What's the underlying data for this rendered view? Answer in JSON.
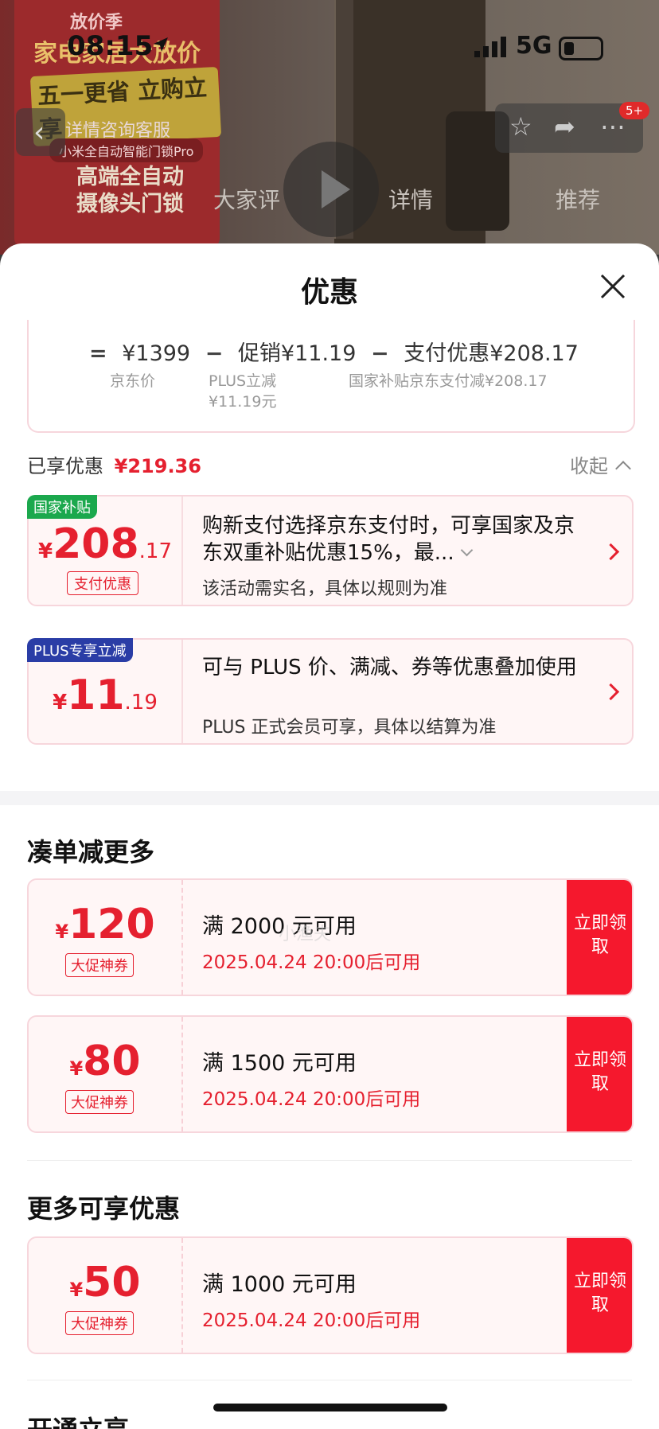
{
  "status_bar": {
    "time": "08:15",
    "network": "5G"
  },
  "backdrop": {
    "promo_top": "放价季",
    "promo_line1": "家电家居大放价",
    "promo_line2": "五一更省 立购立享",
    "consult": "详情咨询客服",
    "product_chip": "小米全自动智能门锁Pro",
    "product_big_1": "高端全自动",
    "product_big_2": "摄像头门锁",
    "tabs": [
      "大家评",
      "详情",
      "推荐"
    ],
    "cart_badge": "5+"
  },
  "sheet": {
    "title": "优惠",
    "calc": {
      "eq": "=",
      "price": "¥1399",
      "minus": "−",
      "promo": "促销¥11.19",
      "pay": "支付优惠¥208.17",
      "price_label": "京东价",
      "promo_label_1": "PLUS立减",
      "promo_label_2": "¥11.19元",
      "pay_label": "国家补贴京东支付减¥208.17"
    },
    "enjoyed_label": "已享优惠",
    "enjoyed_amount": "¥219.36",
    "collapse_label": "收起",
    "promos": [
      {
        "tag": "国家补贴",
        "currency": "¥",
        "int": "208",
        "dec": ".17",
        "chip": "支付优惠",
        "text": "购新支付选择京东支付时，可享国家及京东双重补贴优惠15%，最...",
        "sub": "该活动需实名，具体以规则为准"
      },
      {
        "tag": "PLUS专享立减",
        "currency": "¥",
        "int": "11",
        "dec": ".19",
        "text": "可与 PLUS 价、满减、券等优惠叠加使用",
        "sub": "PLUS 正式会员可享，具体以结算为准"
      }
    ],
    "section_more": "凑单减更多",
    "coupons_more": [
      {
        "currency": "¥",
        "amount": "120",
        "chip": "大促神券",
        "condition": "满 2000 元可用",
        "time": "2025.04.24 20:00后可用",
        "claim": "立即领取"
      },
      {
        "currency": "¥",
        "amount": "80",
        "chip": "大促神券",
        "condition": "满 1500 元可用",
        "time": "2025.04.24 20:00后可用",
        "claim": "立即领取"
      }
    ],
    "section_extra": "更多可享优惠",
    "coupons_extra": [
      {
        "currency": "¥",
        "amount": "50",
        "chip": "大促神券",
        "condition": "满 1000 元可用",
        "time": "2025.04.24 20:00后可用",
        "claim": "立即领取"
      }
    ],
    "section_cut": "开通立享",
    "watermark": "小渔夫"
  },
  "colors": {
    "accent": "#e5202f",
    "claim_bg": "#f5182d",
    "national_tag": "#1ba84d",
    "plus_tag": "#2a3da6"
  },
  "icons": [
    "location-arrow-icon",
    "signal-icon",
    "battery-icon",
    "back-icon",
    "star-icon",
    "share-icon",
    "more-icon",
    "play-icon",
    "close-icon",
    "chevron-up-icon",
    "chevron-right-icon",
    "chevron-down-icon"
  ]
}
